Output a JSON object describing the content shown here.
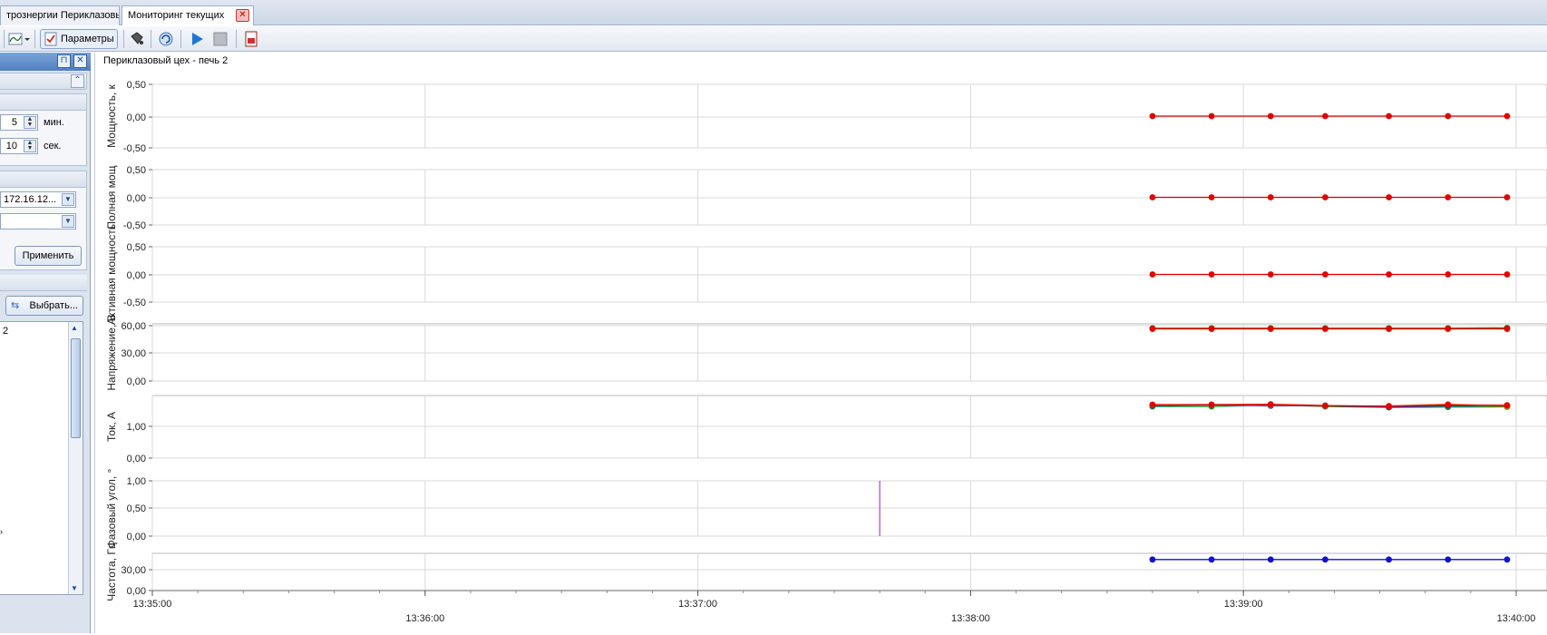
{
  "tabs": [
    {
      "label": "трознергии Периклазовь"
    },
    {
      "label": "Мониторинг текущих"
    }
  ],
  "toolbar": {
    "params_label": "Параметры"
  },
  "left_panel": {
    "interval_minutes": "5",
    "interval_minutes_unit": "мин.",
    "refresh_seconds": "10",
    "refresh_seconds_unit": "сек.",
    "server_value": "172.16.12...",
    "second_combo_value": "",
    "apply_label": "Применить",
    "select_label": "Выбрать...",
    "list_items": [
      "2"
    ]
  },
  "chart_title": "Периклазовый цех - печь 2",
  "chart_data": {
    "type": "line",
    "x_ticks": [
      "13:35:00",
      "13:36:00",
      "13:37:00",
      "13:38:00",
      "13:39:00",
      "13:40:00"
    ],
    "x_times": [
      "13:38:40",
      "13:38:53",
      "13:39:06",
      "13:39:18",
      "13:39:32",
      "13:39:45",
      "13:39:58"
    ],
    "panels": [
      {
        "ylabel": "Мощность, к",
        "yticks": [
          "0,50",
          "0,00",
          "-0,50"
        ],
        "ylim": [
          -0.5,
          0.5
        ],
        "series": [
          {
            "color": "#e00000",
            "values": [
              0,
              0,
              0,
              0,
              0,
              0,
              0
            ]
          }
        ]
      },
      {
        "ylabel": "Полная мощ",
        "yticks": [
          "0,50",
          "0,00",
          "-0,50"
        ],
        "ylim": [
          -0.5,
          0.5
        ],
        "series": [
          {
            "color": "#e00000",
            "values": [
              0,
              0,
              0,
              0,
              0,
              0,
              0
            ]
          }
        ]
      },
      {
        "ylabel": "Активная мощность",
        "yticks": [
          "0,50",
          "0,00",
          "-0,50"
        ],
        "ylim": [
          -0.5,
          0.5
        ],
        "series": [
          {
            "color": "#e00000",
            "values": [
              0,
              0,
              0,
              0,
              0,
              0,
              0
            ]
          }
        ]
      },
      {
        "ylabel": "Напряжение, В",
        "yticks": [
          "60,00",
          "30,00",
          "0,00"
        ],
        "ylim": [
          0,
          60
        ],
        "series": [
          {
            "color": "#1a8f1a",
            "values": [
              55.5,
              55.5,
              55.5,
              55.5,
              55.5,
              55.5,
              55.8
            ]
          },
          {
            "color": "#e06010",
            "values": [
              54.6,
              54.6,
              54.6,
              54.6,
              54.6,
              54.6,
              54.6
            ]
          },
          {
            "color": "#e00000",
            "values": [
              55.0,
              55.0,
              55.0,
              55.0,
              55.0,
              55.0,
              55.0
            ]
          }
        ]
      },
      {
        "ylabel": "Ток, А",
        "yticks": [
          "1,00",
          "0,00"
        ],
        "ylim": [
          0,
          2.0
        ],
        "series": [
          {
            "color": "#1a8f1a",
            "values": [
              1.65,
              1.65,
              1.7,
              1.65,
              1.62,
              1.63,
              1.64
            ]
          },
          {
            "color": "#1040d0",
            "values": [
              1.68,
              1.7,
              1.67,
              1.67,
              1.63,
              1.67,
              1.68
            ]
          },
          {
            "color": "#e06010",
            "values": [
              1.7,
              1.71,
              1.7,
              1.67,
              1.67,
              1.72,
              1.66
            ]
          },
          {
            "color": "#e00000",
            "values": [
              1.71,
              1.71,
              1.72,
              1.68,
              1.65,
              1.7,
              1.69
            ]
          }
        ]
      },
      {
        "ylabel": "Фазовый угол, °",
        "yticks": [
          "1,00",
          "0,50",
          "0,00"
        ],
        "ylim": [
          0,
          1.0
        ],
        "series": [],
        "marker": {
          "time": "13:37:40",
          "color": "#b040c0"
        }
      },
      {
        "ylabel": "Частота, Гц",
        "yticks": [
          "30,00",
          "0,00"
        ],
        "ylim": [
          0,
          60
        ],
        "series": [
          {
            "color": "#1010d0",
            "values": [
              50,
              50,
              50,
              50,
              50,
              50,
              50
            ]
          }
        ]
      }
    ]
  }
}
